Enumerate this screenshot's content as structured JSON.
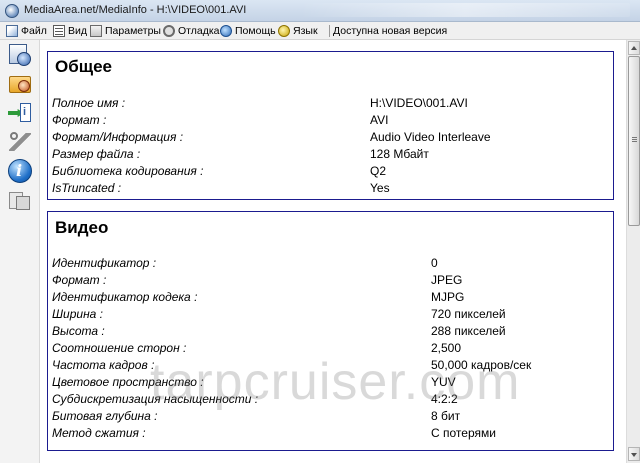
{
  "window": {
    "title": "MediaArea.net/MediaInfo - H:\\VIDEO\\001.AVI"
  },
  "menu": {
    "file": "Файл",
    "view": "Вид",
    "params": "Параметры",
    "debug": "Отладка",
    "help": "Помощь",
    "language": "Язык",
    "update": "Доступна новая версия"
  },
  "sidebar": {
    "items": [
      "open-file-icon",
      "open-folder-icon",
      "export-icon",
      "preferences-icon",
      "about-icon",
      "donate-icon"
    ]
  },
  "general": {
    "title": "Общее",
    "rows": [
      {
        "key": "Полное имя :",
        "value": "H:\\VIDEO\\001.AVI"
      },
      {
        "key": "Формат :",
        "value": "AVI"
      },
      {
        "key": "Формат/Информация :",
        "value": "Audio Video Interleave"
      },
      {
        "key": "Размер файла :",
        "value": "128 Мбайт"
      },
      {
        "key": "Библиотека кодирования :",
        "value": "Q2"
      },
      {
        "key": "IsTruncated :",
        "value": "Yes"
      }
    ]
  },
  "video": {
    "title": "Видео",
    "rows": [
      {
        "key": "Идентификатор :",
        "value": "0"
      },
      {
        "key": "Формат :",
        "value": "JPEG"
      },
      {
        "key": "Идентификатор кодека :",
        "value": "MJPG"
      },
      {
        "key": "Ширина :",
        "value": "720 пикселей"
      },
      {
        "key": "Высота :",
        "value": "288 пикселей"
      },
      {
        "key": "Соотношение сторон :",
        "value": "2,500"
      },
      {
        "key": "Частота кадров :",
        "value": "50,000 кадров/сек"
      },
      {
        "key": "Цветовое пространство :",
        "value": "YUV"
      },
      {
        "key": "Субдискретизация насыщенности :",
        "value": "4:2:2"
      },
      {
        "key": "Битовая глубина :",
        "value": "8 бит"
      },
      {
        "key": "Метод сжатия :",
        "value": "С потерями"
      }
    ]
  },
  "watermark": "tarpcruiser.com"
}
